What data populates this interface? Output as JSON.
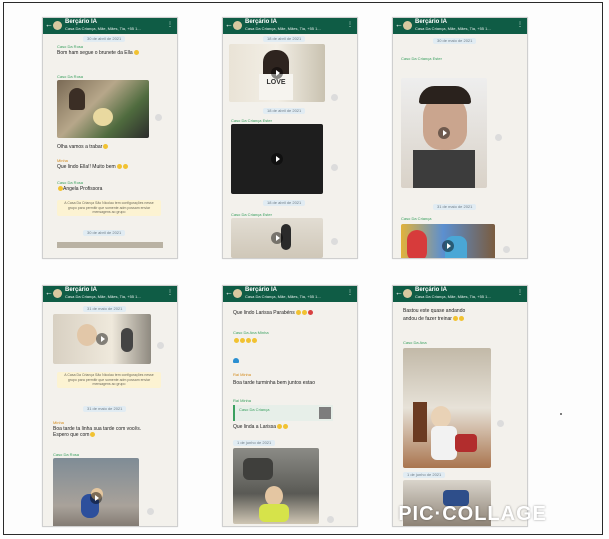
{
  "collage": {
    "watermark": "PIC·COLLAGE"
  },
  "chat": {
    "name": "Berçário IA",
    "subtitle": "Casa Da Criança, Mãe, Mães, Tia, +55 1...",
    "back_icon": "arrow-left-icon",
    "header_color": "#0f5c45"
  },
  "panels": [
    {
      "date1": "30 de abril de 2021",
      "sender1": "Caso Da Rosa",
      "msg1": "Bom ham segue o brunete da Ella",
      "sender2": "Caso Da Rosa",
      "msg2": "Olha vamos a trabar",
      "sender3": "Minha",
      "msg3": "Que lindo Ella!! Muito bem",
      "sender4": "Caso Da Rosa",
      "msg4": "Angela Profissora",
      "sys": "A Casa Da Criança São Nicolau tem configurações nesse grupo para permitir que somente adm possam enviar mensagens ao grupo",
      "date2": "30 de abril de 2021"
    },
    {
      "date1": "18 de abril de 2021",
      "video_text": "LOVE",
      "date2": "18 de abril de 2021",
      "sender1": "Caso Da Criança Ester",
      "date3": "18 de abril de 2021",
      "sender2": "Caso Da Criança Ester"
    },
    {
      "date1": "30 de maio de 2021",
      "sender1": "Caso Da Criança Ester",
      "date2": "31 de maio de 2021",
      "sender2": "Caso Da Criança"
    },
    {
      "date1": "31 de maio de 2021",
      "sys": "A Casa Da Criança São Nicolau tem configurações nesse grupo para permitir que somente adm possam enviar mensagens ao grupo",
      "date2": "31 de maio de 2021",
      "sender1": "Minha",
      "msg1": "Boa tarde ta linha sua tarde com vocês. Espero que com",
      "sender2": "Caso Da Rosa"
    },
    {
      "msg1": "Que lindo Larissa Parabéns",
      "sender1": "Caso Da Ana Minha",
      "sender2": "Rai Minha",
      "msg2": "Boa tarde turminha bem juntos estao",
      "sender3": "Rai Minha",
      "quote": "Caso Da Criança",
      "msg3": "Que linda a Larissa",
      "date1": "1 de junho de 2021"
    },
    {
      "msg1": "Bastou este quase andando",
      "msg2": "andou de fazer treinar",
      "sender1": "Caso Da Ana",
      "date1": "1 de junho de 2021"
    }
  ]
}
